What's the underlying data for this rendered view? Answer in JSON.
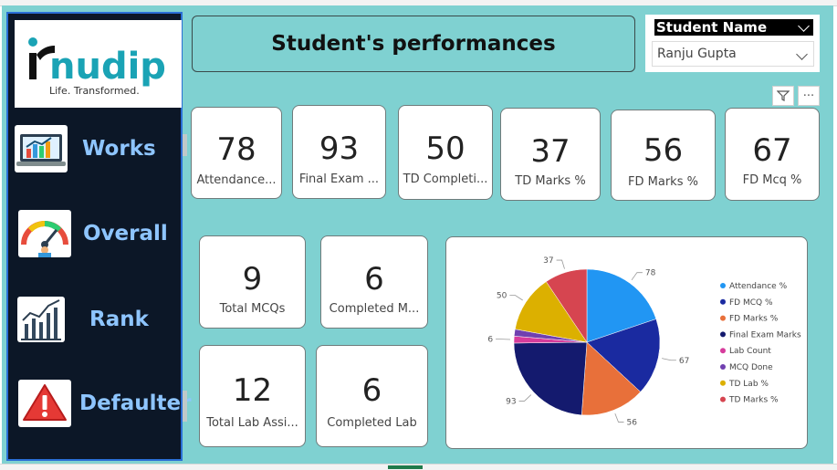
{
  "title": "Student's performances",
  "slicer": {
    "header": "Student Name",
    "selected": "Ranju Gupta"
  },
  "logo": {
    "brand": "nudip",
    "brand_prefix": "i",
    "tagline": "Life. Transformed."
  },
  "nav": [
    {
      "label": "Works",
      "icon": "laptop-chart-icon"
    },
    {
      "label": "Overall",
      "icon": "gauge-icon"
    },
    {
      "label": "Rank",
      "icon": "line-chart-icon"
    },
    {
      "label": "Defaulter",
      "icon": "warning-icon"
    }
  ],
  "cards_top": [
    {
      "value": "78",
      "label": "Attendance..."
    },
    {
      "value": "93",
      "label": "Final Exam ..."
    },
    {
      "value": "50",
      "label": "TD Completi..."
    },
    {
      "value": "37",
      "label": "TD Marks %"
    },
    {
      "value": "56",
      "label": "FD Marks %"
    },
    {
      "value": "67",
      "label": "FD Mcq %"
    }
  ],
  "cards_mid": [
    {
      "value": "9",
      "label": "Total MCQs"
    },
    {
      "value": "6",
      "label": "Completed M..."
    },
    {
      "value": "12",
      "label": "Total Lab Assi..."
    },
    {
      "value": "6",
      "label": "Completed Lab"
    }
  ],
  "chart_data": {
    "type": "pie",
    "categories": [
      "Attendance %",
      "FD MCQ %",
      "FD Marks %",
      "Final Exam Marks",
      "Lab Count",
      "MCQ Done",
      "TD Lab %",
      "TD Marks %"
    ],
    "values": [
      78,
      67,
      56,
      93,
      6,
      6,
      50,
      37
    ],
    "colors": [
      "#2196f3",
      "#1a2aa0",
      "#e8703a",
      "#141a6e",
      "#d63c9c",
      "#7040b0",
      "#dcb000",
      "#d64550"
    ],
    "data_labels": [
      "78",
      "67",
      "56",
      "93",
      "6",
      "",
      "50",
      "37"
    ],
    "legend": "right"
  },
  "colors": {
    "canvas": "#7fd1d1",
    "sidebar": "#0c1727",
    "nav_text": "#8ec5ff",
    "brand": "#1aa3b5"
  }
}
